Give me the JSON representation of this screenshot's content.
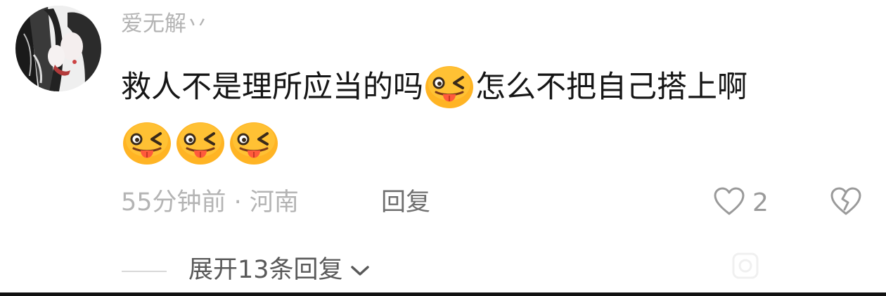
{
  "comment": {
    "username": "爱无解丷",
    "text_part1": "救人不是理所应当的吗",
    "text_part2": "怎么不把自己搭上啊",
    "inline_emoji": "tongue-wink-emoji",
    "trailing_emojis": [
      "tongue-wink-emoji",
      "tongue-wink-emoji",
      "tongue-wink-emoji"
    ],
    "time_location": "55分钟前 · 河南",
    "reply_label": "回复",
    "like_count": "2",
    "expand_label": "展开13条回复"
  },
  "icons": {
    "like": "heart-outline-icon",
    "dislike": "broken-heart-icon",
    "expand": "chevron-down-icon"
  },
  "colors": {
    "text_primary": "#161616",
    "text_secondary": "#b4b4b4",
    "reply_text": "#6f6f6f",
    "emoji_face": "#ffb424",
    "emoji_tongue": "#ff5a3c"
  }
}
